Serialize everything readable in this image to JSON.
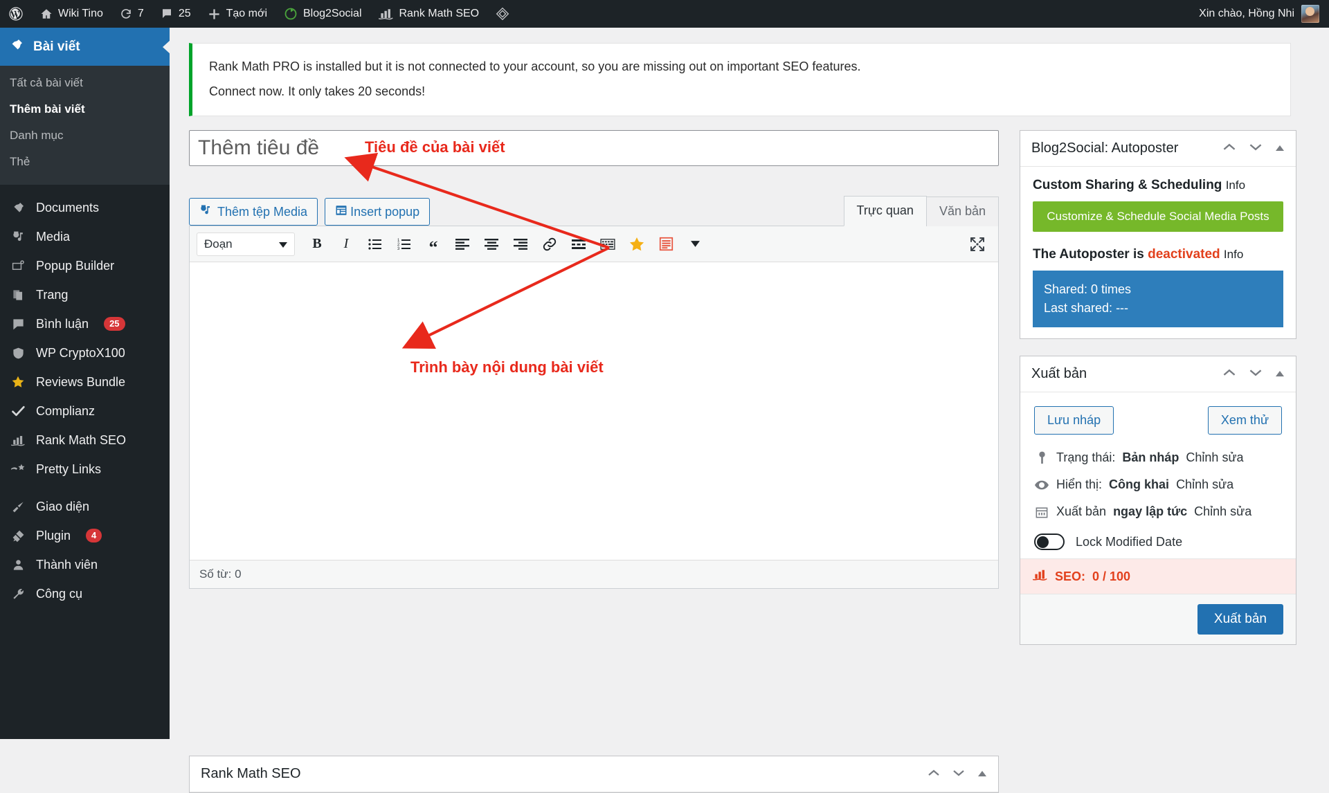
{
  "adminbar": {
    "items": [
      {
        "icon": "wordpress-logo-icon",
        "label": ""
      },
      {
        "icon": "home-icon",
        "label": "Wiki Tino"
      },
      {
        "icon": "update-icon",
        "label": "7"
      },
      {
        "icon": "comment-icon",
        "label": "25"
      },
      {
        "icon": "plus-icon",
        "label": "Tạo mới"
      },
      {
        "icon": "blog2social-icon",
        "label": "Blog2Social"
      },
      {
        "icon": "rankmath-icon",
        "label": "Rank Math SEO"
      },
      {
        "icon": "diamond-icon",
        "label": ""
      }
    ],
    "greeting": "Xin chào, Hồng Nhi"
  },
  "sidebar": {
    "current": {
      "icon": "pin-icon",
      "label": "Bài viết"
    },
    "submenu": [
      {
        "label": "Tất cả bài viết",
        "current": false
      },
      {
        "label": "Thêm bài viết",
        "current": true
      },
      {
        "label": "Danh mục",
        "current": false
      },
      {
        "label": "Thẻ",
        "current": false
      }
    ],
    "items": [
      {
        "icon": "pin-icon",
        "label": "Documents",
        "count": ""
      },
      {
        "icon": "media-icon",
        "label": "Media",
        "count": ""
      },
      {
        "icon": "popup-icon",
        "label": "Popup Builder",
        "count": ""
      },
      {
        "icon": "page-icon",
        "label": "Trang",
        "count": ""
      },
      {
        "icon": "comment-icon",
        "label": "Bình luận",
        "count": "25"
      },
      {
        "icon": "shield-icon",
        "label": "WP CryptoX100",
        "count": ""
      },
      {
        "icon": "star-icon",
        "label": "Reviews Bundle",
        "count": ""
      },
      {
        "icon": "check-icon",
        "label": "Complianz",
        "count": ""
      },
      {
        "icon": "rankmath-icon",
        "label": "Rank Math SEO",
        "count": ""
      },
      {
        "icon": "link-star-icon",
        "label": "Pretty Links",
        "count": ""
      },
      {
        "icon": "brush-icon",
        "label": "Giao diện",
        "count": ""
      },
      {
        "icon": "plug-icon",
        "label": "Plugin",
        "count": "4"
      },
      {
        "icon": "user-icon",
        "label": "Thành viên",
        "count": ""
      },
      {
        "icon": "wrench-icon",
        "label": "Công cụ",
        "count": ""
      }
    ]
  },
  "notice": {
    "line1": "Rank Math PRO is installed but it is not connected to your account, so you are missing out on important SEO features.",
    "line2": "Connect now. It only takes 20 seconds!",
    "accent_color": "#00a32a"
  },
  "editor": {
    "title_placeholder": "Thêm tiêu đề",
    "add_media_label": "Thêm tệp Media",
    "insert_popup_label": "Insert popup",
    "tabs": [
      {
        "label": "Trực quan",
        "active": true
      },
      {
        "label": "Văn bản",
        "active": false
      }
    ],
    "format_select": "Đoạn",
    "toolbar_icons": [
      "bold-icon",
      "italic-icon",
      "bulleted-list-icon",
      "numbered-list-icon",
      "blockquote-icon",
      "align-left-icon",
      "align-center-icon",
      "align-right-icon",
      "link-icon",
      "read-more-icon",
      "keyboard-icon",
      "star-icon",
      "table-of-contents-icon",
      "toolbar-toggle-icon",
      "fullscreen-icon"
    ],
    "word_count": "Số từ: 0",
    "bottom_panel_title": "Rank Math SEO"
  },
  "blog2social": {
    "panel_title": "Blog2Social: Autoposter",
    "heading": "Custom Sharing & Scheduling",
    "heading_info": "Info",
    "button_label": "Customize & Schedule Social Media Posts",
    "button_color": "#76b82a",
    "status_prefix": "The Autoposter is",
    "status_value": "deactivated",
    "status_info": "Info",
    "status_color": "#e2401c",
    "shared_line": "Shared: 0 times",
    "last_shared_line": "Last shared: ---",
    "info_box_color": "#2e7ebb"
  },
  "publish": {
    "panel_title": "Xuất bản",
    "save_draft_label": "Lưu nháp",
    "preview_label": "Xem thử",
    "status": {
      "icon": "pin-marker-icon",
      "label": "Trạng thái:",
      "value": "Bản nháp",
      "edit": "Chỉnh sửa"
    },
    "visibility": {
      "icon": "eye-icon",
      "label": "Hiển thị:",
      "value": "Công khai",
      "edit": "Chỉnh sửa"
    },
    "schedule": {
      "icon": "calendar-icon",
      "label": "Xuất bản",
      "value": "ngay lập tức",
      "edit": "Chỉnh sửa"
    },
    "lock_modified_label": "Lock Modified Date",
    "lock_modified_on": false,
    "seo_icon": "rankmath-icon",
    "seo_label": "SEO:",
    "seo_score": "0 / 100",
    "seo_color": "#e2401c",
    "publish_label": "Xuất bản",
    "publish_color": "#2271b1"
  },
  "annotations": [
    {
      "text": "Tiêu đề của bài viết",
      "color": "#e8291c"
    },
    {
      "text": "Trình bày nội dung bài viết",
      "color": "#e8291c"
    }
  ]
}
